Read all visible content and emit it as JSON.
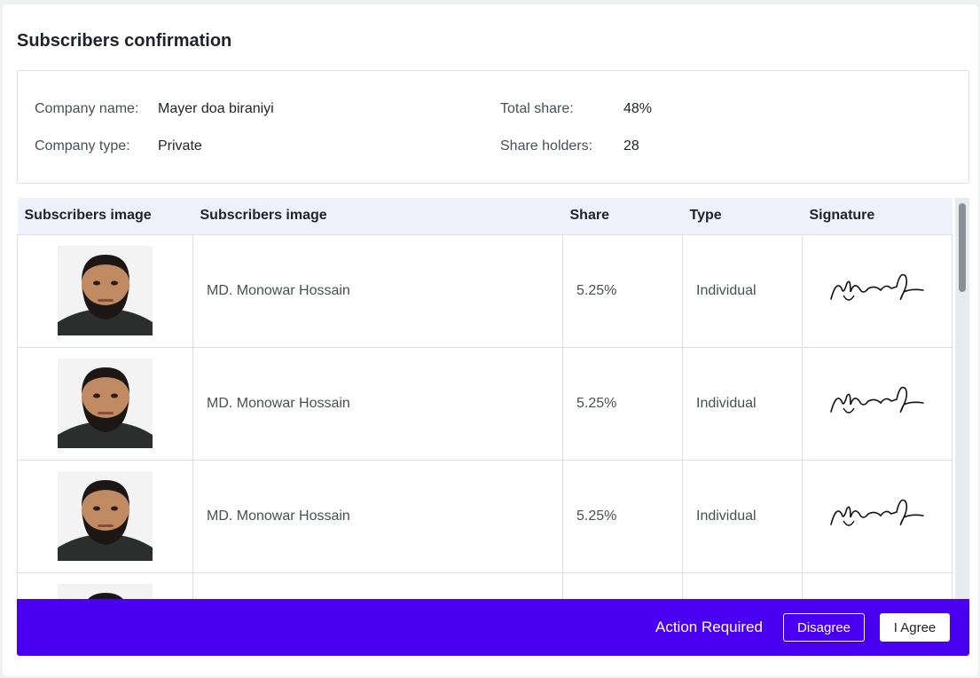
{
  "page": {
    "title": "Subscribers confirmation"
  },
  "company": {
    "name_label": "Company name:",
    "name_value": "Mayer doa biraniyi",
    "type_label": "Company type:",
    "type_value": "Private",
    "total_share_label": "Total share:",
    "total_share_value": "48%",
    "share_holders_label": "Share holders:",
    "share_holders_value": "28"
  },
  "table": {
    "columns": [
      "Subscribers image",
      "Subscribers image",
      "Share",
      "Type",
      "Signature"
    ],
    "rows": [
      {
        "name": "MD. Monowar Hossain",
        "share": "5.25%",
        "type": "Individual"
      },
      {
        "name": "MD. Monowar Hossain",
        "share": "5.25%",
        "type": "Individual"
      },
      {
        "name": "MD. Monowar Hossain",
        "share": "5.25%",
        "type": "Individual"
      },
      {
        "name": "",
        "share": "",
        "type": ""
      }
    ]
  },
  "action_bar": {
    "text": "Action Required",
    "disagree_label": "Disagree",
    "agree_label": "I Agree",
    "background": "#4a00f0"
  }
}
